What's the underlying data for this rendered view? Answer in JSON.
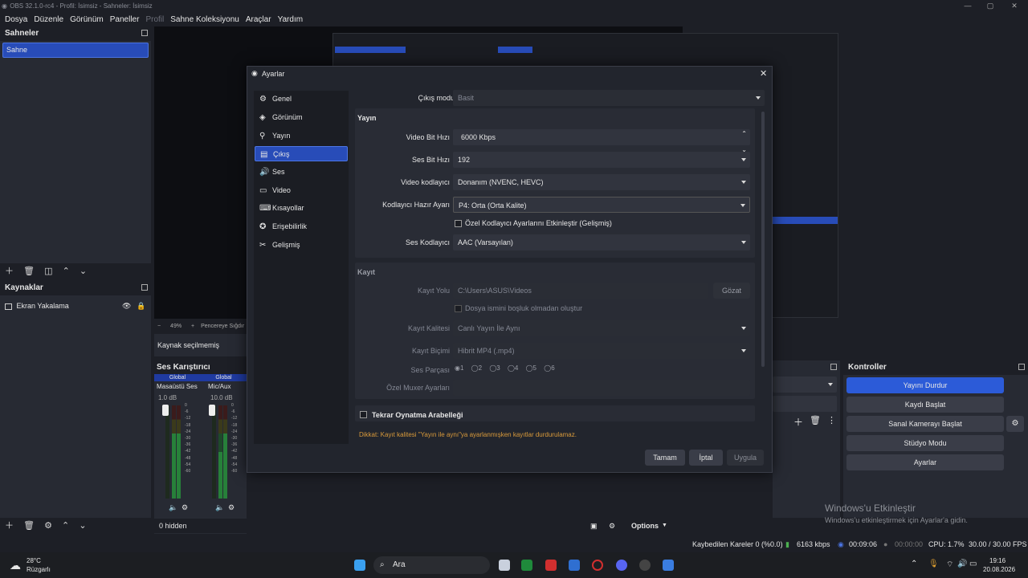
{
  "window": {
    "title": "OBS 32.1.0-rc4 - Profil: İsimsiz - Sahneler: İsimsiz"
  },
  "menu": [
    "Dosya",
    "Düzenle",
    "Görünüm",
    "Paneller",
    "Profil",
    "Sahne Koleksiyonu",
    "Araçlar",
    "Yardım"
  ],
  "scenes": {
    "title": "Sahneler",
    "items": [
      "Sahne"
    ]
  },
  "sources": {
    "title": "Kaynaklar",
    "items": [
      "Ekran Yakalama"
    ]
  },
  "preview_bar": {
    "zoom": "49%",
    "fit": "Pencereye Sığdır"
  },
  "no_source": "Kaynak seçilmemiş",
  "mixer": {
    "title": "Ses Karıştırıcı",
    "channels": [
      {
        "badge": "Global",
        "name": "Masaüstü Ses",
        "db": "1.0 dB"
      },
      {
        "badge": "Global",
        "name": "Mic/Aux",
        "db": "10.0 dB"
      }
    ],
    "scale": [
      "0",
      "-6",
      "-12",
      "-18",
      "-24",
      "-30",
      "-36",
      "-42",
      "-48",
      "-54",
      "-60"
    ]
  },
  "hidden_count": "0 hidden",
  "options_label": "Options",
  "controls": {
    "title": "Kontroller",
    "buttons": [
      "Yayını Durdur",
      "Kaydı Başlat",
      "Sanal Kamerayı Başlat",
      "Stüdyo Modu",
      "Ayarlar"
    ]
  },
  "activation": {
    "title": "Windows'u Etkinleştir",
    "subtitle": "Windows'u etkinleştirmek için Ayarlar'a gidin."
  },
  "dialog": {
    "title": "Ayarlar",
    "nav": [
      "Genel",
      "Görünüm",
      "Yayın",
      "Çıkış",
      "Ses",
      "Video",
      "Kısayollar",
      "Erişebilirlik",
      "Gelişmiş"
    ],
    "nav_icons": [
      "gear-icon",
      "eye-icon",
      "antenna-icon",
      "output-icon",
      "speaker-icon",
      "monitor-icon",
      "keyboard-icon",
      "accessibility-icon",
      "tools-icon"
    ],
    "output_mode_label": "Çıkış modu",
    "output_mode": "Basit",
    "stream": {
      "title": "Yayın",
      "video_bitrate_label": "Video Bit Hızı",
      "video_bitrate": "6000 Kbps",
      "audio_bitrate_label": "Ses Bit Hızı",
      "audio_bitrate": "192",
      "video_encoder_label": "Video kodlayıcı",
      "video_encoder": "Donanım (NVENC, HEVC)",
      "preset_label": "Kodlayıcı Hazır Ayarı",
      "preset": "P4: Orta (Orta Kalite)",
      "custom_check": "Özel Kodlayıcı Ayarlarını Etkinleştir (Gelişmiş)",
      "audio_encoder_label": "Ses Kodlayıcı",
      "audio_encoder": "AAC (Varsayılan)"
    },
    "record": {
      "title": "Kayıt",
      "path_label": "Kayıt Yolu",
      "path": "C:\\Users\\ASUS\\Videos",
      "browse": "Gözat",
      "nospace_check": "Dosya ismini boşluk olmadan oluştur",
      "quality_label": "Kayıt Kalitesi",
      "quality": "Canlı Yayın İle Aynı",
      "format_label": "Kayıt Biçimi",
      "format": "Hibrit MP4 (.mp4)",
      "tracks_label": "Ses Parçası",
      "tracks": [
        "1",
        "2",
        "3",
        "4",
        "5",
        "6"
      ],
      "muxer_label": "Özel Muxer Ayarları",
      "muxer": ""
    },
    "replay_label": "Tekrar Oynatma Arabelleği",
    "warning": "Dikkat: Kayıt kalitesi \"Yayın ile aynı\"ya ayarlanmışken kayıtlar durdurulamaz.",
    "buttons": {
      "ok": "Tamam",
      "cancel": "İptal",
      "apply": "Uygula"
    }
  },
  "status": {
    "dropped": "Kaybedilen Kareler 0 (%0.0)",
    "bitrate": "6163 kbps",
    "stream_time": "00:09:06",
    "rec_time": "00:00:00",
    "cpu": "CPU: 1.7%",
    "fps": "30.00 / 30.00 FPS"
  },
  "taskbar": {
    "temp": "28°C",
    "weather": "Rüzgarlı",
    "search": "Ara",
    "time": "19:16",
    "date": "20.08.2026"
  },
  "colors": {
    "accent": "#284cb8",
    "bg": "#1d1f26",
    "panel": "#272a33",
    "warning": "#d99a3b",
    "live": "#2c5bd8"
  }
}
